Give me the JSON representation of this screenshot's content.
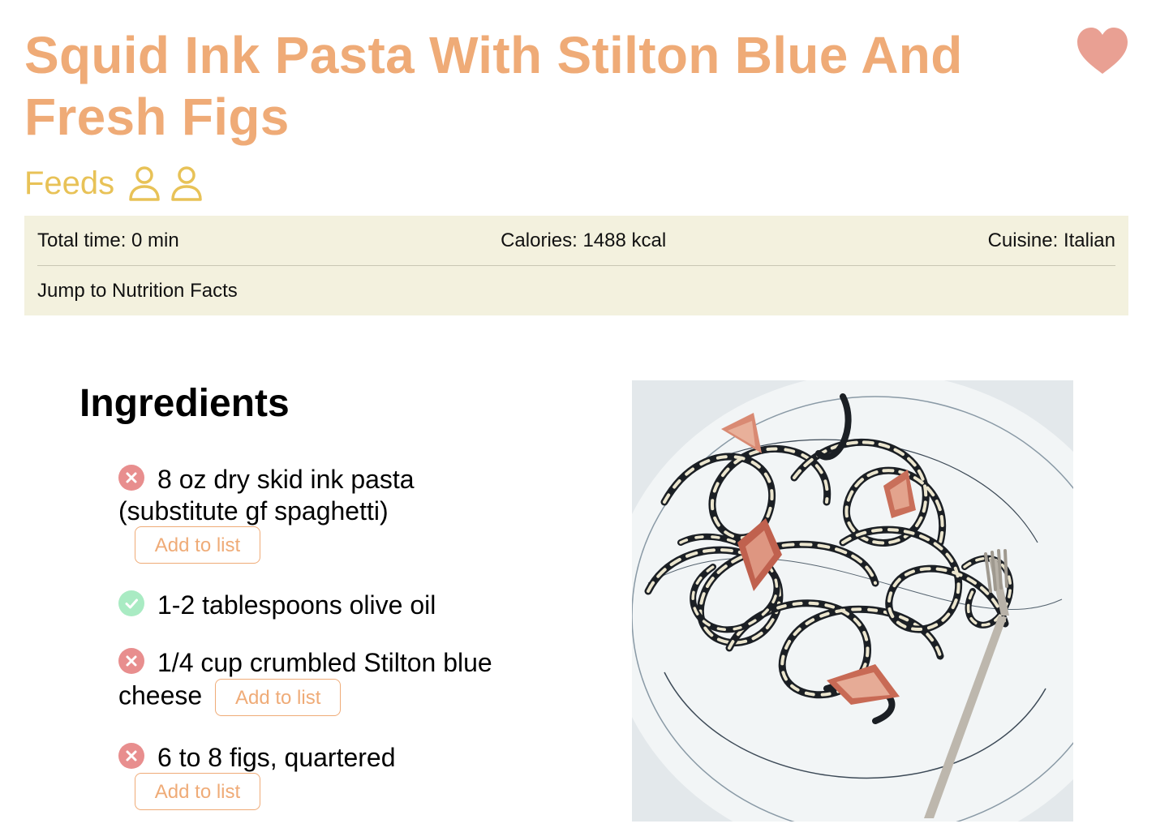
{
  "recipe": {
    "title": "Squid Ink Pasta With Stilton Blue And Fresh Figs",
    "feeds_label": "Feeds",
    "servings": 2,
    "favorited": true
  },
  "info_bar": {
    "total_time": "Total time: 0 min",
    "calories": "Calories: 1488 kcal",
    "cuisine": "Cuisine: Italian",
    "jump_link": "Jump to Nutrition Facts"
  },
  "ingredients": {
    "heading": "Ingredients",
    "items": [
      {
        "text": "8 oz dry skid ink pasta (substitute gf spaghetti)",
        "in_pantry": false,
        "button_label": "Add to list"
      },
      {
        "text": "1-2 tablespoons olive oil",
        "in_pantry": true
      },
      {
        "text": "1/4 cup crumbled Stilton blue cheese",
        "in_pantry": false,
        "button_label": "Add to list"
      },
      {
        "text": "6 to 8 figs, quartered",
        "in_pantry": false,
        "button_label": "Add to list"
      }
    ]
  },
  "colors": {
    "title": "#efab77",
    "feeds": "#e8c257",
    "favorite": "#e9a093",
    "info_bg": "#f3f1de",
    "missing_status": "#e88e8e",
    "have_status": "#a9ebc3"
  },
  "icons": {
    "favorite": "heart-icon",
    "serving": "person-icon",
    "missing": "x-circle-icon",
    "have": "check-circle-icon"
  }
}
